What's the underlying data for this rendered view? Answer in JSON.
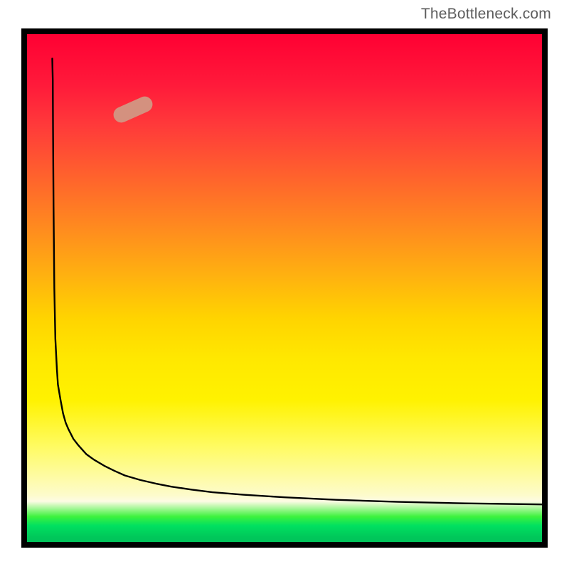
{
  "watermark": "TheBottleneck.com",
  "blob": {
    "cx_pct": 20.6,
    "cy_pct": 14.9
  },
  "chart_data": {
    "type": "line",
    "title": "",
    "xlabel": "",
    "ylabel": "",
    "xlim": [
      0,
      100
    ],
    "ylim": [
      0,
      100
    ],
    "grid": false,
    "legend": false,
    "annotations": [
      {
        "text": "TheBottleneck.com",
        "position": "top-right"
      }
    ],
    "series": [
      {
        "name": "curve",
        "x": [
          4.9,
          5.0,
          5.05,
          5.15,
          5.3,
          5.5,
          5.8,
          6.0,
          6.5,
          7.0,
          7.5,
          8.0,
          9.0,
          10.0,
          11.5,
          13.0,
          15.0,
          17,
          19,
          22,
          25,
          28,
          32,
          36,
          42,
          50,
          60,
          72,
          85,
          100
        ],
        "y": [
          95.2,
          91,
          81,
          66,
          50,
          40,
          34,
          31,
          28,
          25.3,
          23.5,
          22.3,
          20.3,
          19.0,
          17.3,
          16.2,
          15.0,
          14.0,
          13.1,
          12.2,
          11.5,
          10.9,
          10.3,
          9.8,
          9.3,
          8.8,
          8.3,
          7.9,
          7.6,
          7.4
        ]
      }
    ],
    "gradient_background": {
      "direction": "top-to-bottom",
      "stops": [
        {
          "pos": 0.0,
          "color": "#ff0033"
        },
        {
          "pos": 0.3,
          "color": "#ff6a2a"
        },
        {
          "pos": 0.56,
          "color": "#ffd400"
        },
        {
          "pos": 0.8,
          "color": "#fffb50"
        },
        {
          "pos": 0.91,
          "color": "#fdfbe0"
        },
        {
          "pos": 0.96,
          "color": "#00e060"
        },
        {
          "pos": 1.0,
          "color": "#00c259"
        }
      ]
    },
    "marker": {
      "shape": "rounded-pill",
      "x": 20.6,
      "y": 14.9,
      "rotation_deg": -24,
      "color": "#d4917f"
    }
  }
}
